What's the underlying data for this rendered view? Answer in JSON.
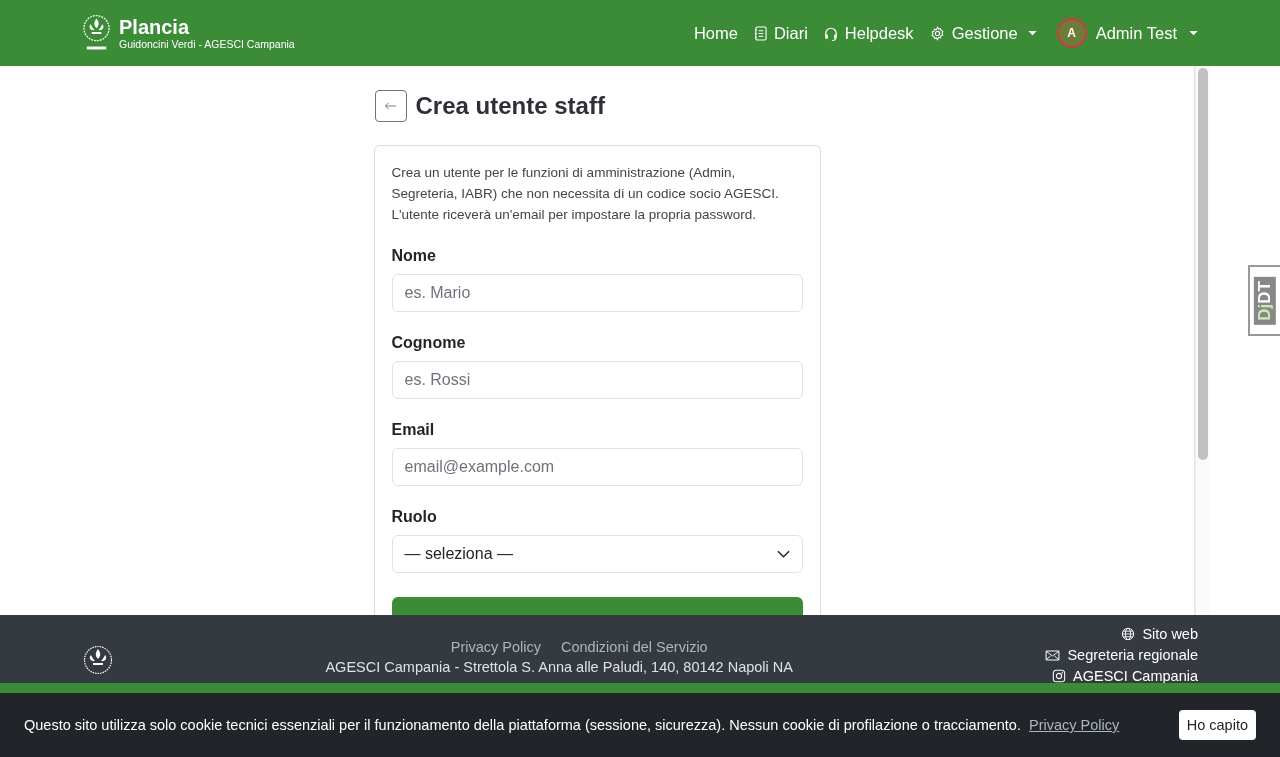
{
  "navbar": {
    "brand": {
      "title": "Plancia",
      "subtitle": "Guidoncini Verdi - AGESCI Campania"
    },
    "links": [
      {
        "label": "Home",
        "dropdown": false
      },
      {
        "label": "Diari",
        "dropdown": false
      },
      {
        "label": "Helpdesk",
        "dropdown": false
      },
      {
        "label": "Gestione",
        "dropdown": true
      }
    ],
    "user": {
      "initial": "A",
      "name": "Admin Test"
    }
  },
  "page": {
    "title": "Crea utente staff",
    "intro": "Crea un utente per le funzioni di amministrazione (Admin, Segreteria, IABR) che non necessita di un codice socio AGESCI. L'utente riceverà un'email per impostare la propria password.",
    "fields": [
      {
        "label": "Nome",
        "kind": "text",
        "placeholder": "es. Mario"
      },
      {
        "label": "Cognome",
        "kind": "text",
        "placeholder": "es. Rossi"
      },
      {
        "label": "Email",
        "kind": "text",
        "placeholder": "email@example.com"
      },
      {
        "label": "Ruolo",
        "kind": "select",
        "value": "— seleziona —"
      }
    ]
  },
  "footer": {
    "links": [
      "Privacy Policy",
      "Condizioni del Servizio"
    ],
    "address": "AGESCI Campania - Strettola S. Anna alle Paludi, 140, 80142 Napoli NA",
    "contacts": [
      {
        "label": "Sito web"
      },
      {
        "label": "Segreteria regionale"
      },
      {
        "label": "AGESCI Campania"
      }
    ]
  },
  "cookie_banner": {
    "text": "Questo sito utilizza solo cookie tecnici essenziali per il funzionamento della piattaforma (sessione, sicurezza). Nessun cookie di profilazione o tracciamento.",
    "link": "Privacy Policy",
    "button": "Ho capito"
  },
  "debug_toolbar": {
    "prefix": "Dj",
    "suffix": "DT"
  }
}
